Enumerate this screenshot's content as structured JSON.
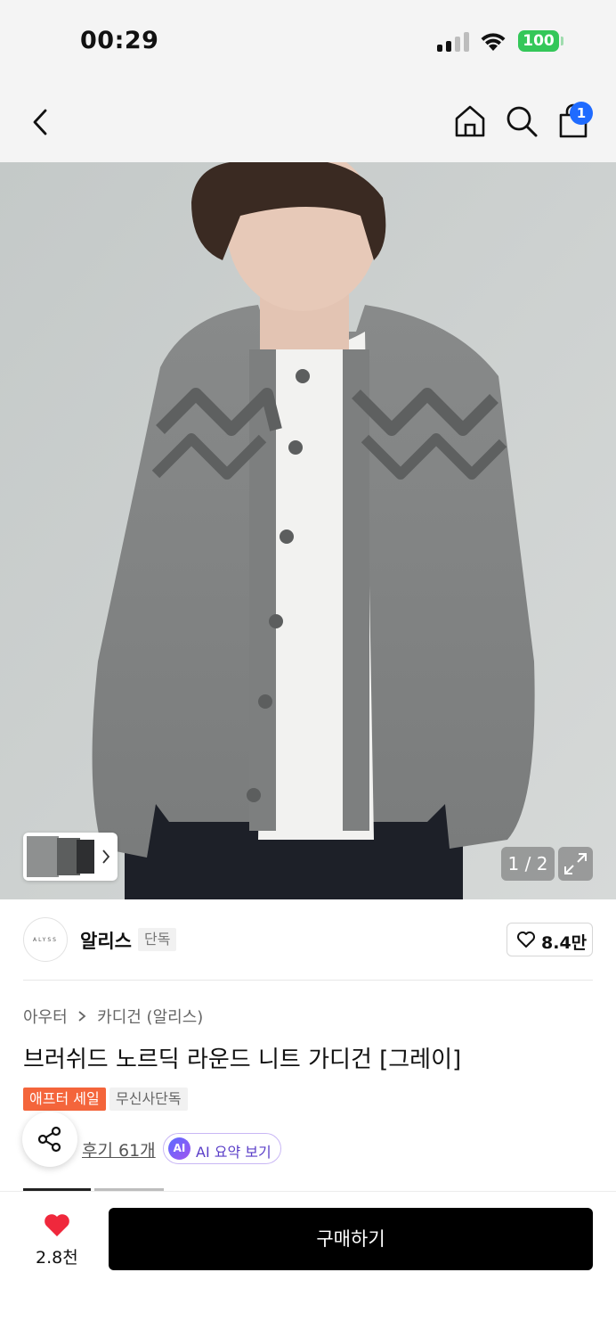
{
  "status_bar": {
    "time": "00:29",
    "battery": "100"
  },
  "nav": {
    "cart_count": "1"
  },
  "gallery": {
    "counter": "1 / 2"
  },
  "brand": {
    "logo_text": "ALYSS",
    "name": "알리스",
    "tag": "단독",
    "like_count": "8.4만"
  },
  "product": {
    "breadcrumb": {
      "category": "아우터",
      "subcategory": "카디건 (알리스)"
    },
    "title": "브러쉬드 노르딕 라운드 니트 가디건 [그레이]",
    "badges": {
      "sale": "애프터 세일",
      "exclusive": "무신사단독"
    },
    "review_link": "후기 61개",
    "ai": {
      "icon_text": "AI",
      "label": "AI 요약 보기"
    }
  },
  "bottom_bar": {
    "wish_count": "2.8천",
    "buy_label": "구매하기"
  },
  "colors": {
    "heart": "#f0283c",
    "sale_badge": "#f4653b",
    "cart_badge": "#1f6bff",
    "battery": "#34c759"
  }
}
